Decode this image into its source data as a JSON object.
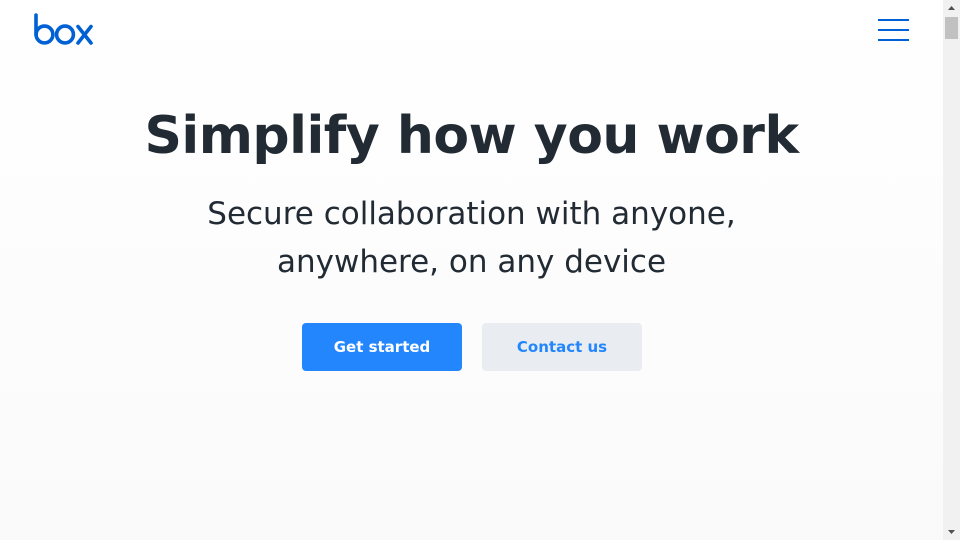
{
  "header": {
    "logo_text": "box",
    "brand_color": "#0061d5",
    "menu_icon": "hamburger-menu-icon"
  },
  "hero": {
    "title": "Simplify how you work",
    "subtitle_line1": "Secure collaboration with anyone,",
    "subtitle_line2": "anywhere, on any device"
  },
  "actions": {
    "primary_label": "Get started",
    "secondary_label": "Contact us",
    "primary_color": "#2486fc",
    "secondary_bg": "#e9edf2"
  },
  "scrollbar": {
    "up_icon": "scroll-up-arrow-icon",
    "down_icon": "scroll-down-arrow-icon"
  }
}
